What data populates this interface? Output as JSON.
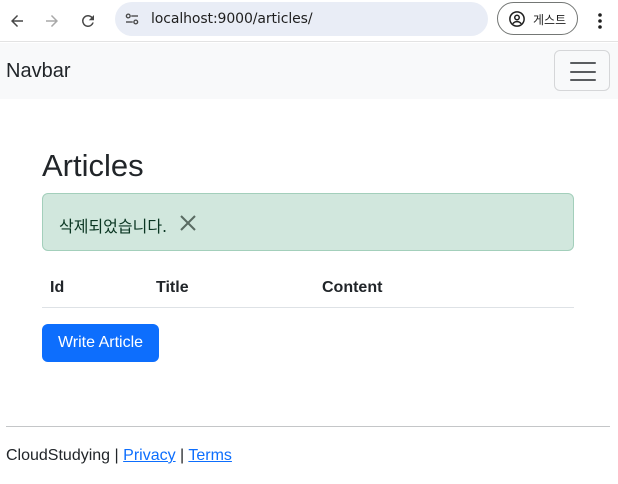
{
  "browser": {
    "url": "localhost:9000/articles/",
    "profile_label": "게스트",
    "icons": [
      "back-arrow-icon",
      "forward-arrow-icon",
      "reload-icon",
      "site-info-icon",
      "profile-icon",
      "more-menu-icon"
    ]
  },
  "navbar": {
    "brand": "Navbar",
    "toggler_icon": "hamburger-icon"
  },
  "main": {
    "title": "Articles",
    "alert": {
      "message": "삭제되었습니다.",
      "close_icon": "close-icon",
      "color": "#d1e7dd"
    },
    "table": {
      "headers": [
        "Id",
        "Title",
        "Content"
      ],
      "rows": []
    },
    "write_button": "Write Article"
  },
  "footer": {
    "brand": "CloudStudying",
    "separator": "|",
    "links": [
      "Privacy",
      "Terms"
    ]
  },
  "colors": {
    "primary": "#0d6efd",
    "navbar_bg": "#f8f9fa",
    "alert_bg": "#d1e7dd",
    "alert_text": "#0a3622"
  }
}
